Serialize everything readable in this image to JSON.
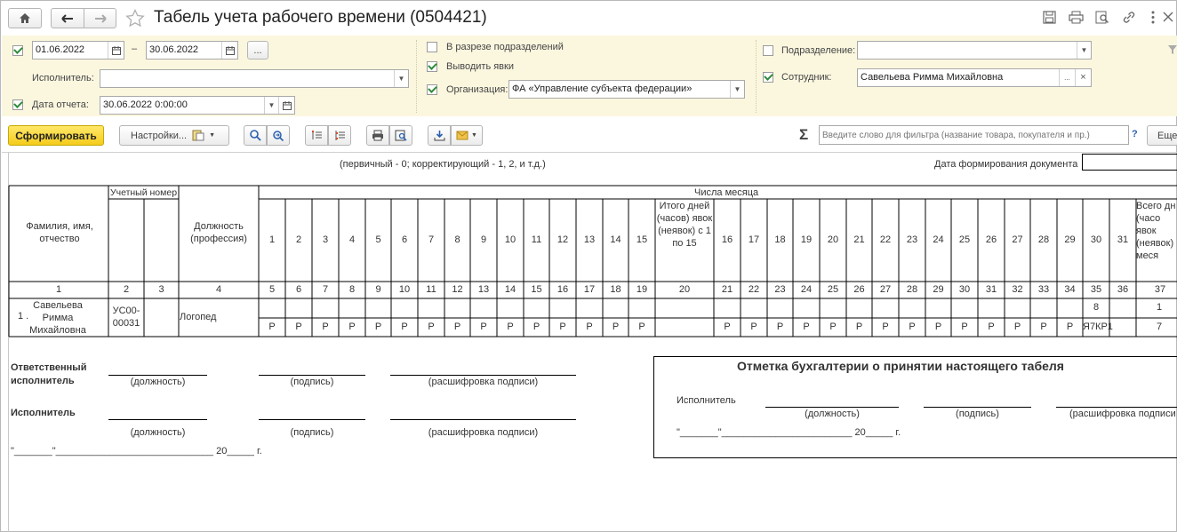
{
  "window": {
    "title": "Табель учета рабочего времени (0504421)"
  },
  "filters": {
    "date_from": "01.06.2022",
    "dash": "–",
    "date_to": "30.06.2022",
    "period_btn": "...",
    "executor_label": "Исполнитель:",
    "executor_value": "",
    "report_date_label": "Дата отчета:",
    "report_date_value": "30.06.2022  0:00:00",
    "by_division_label": "В разрезе подразделений",
    "show_attendance_label": "Выводить явки",
    "organization_label": "Организация:",
    "organization_value": "ФА «Управление субъекта федерации»",
    "division_label": "Подразделение:",
    "division_value": "",
    "employee_label": "Сотрудник:",
    "employee_value": "Савельева Римма Михайловна",
    "more": "...",
    "clear": "×"
  },
  "toolbar": {
    "generate": "Сформировать",
    "settings": "Настройки...",
    "search_placeholder": "Введите слово для фильтра (название товара, покупателя и пр.)",
    "help": "?",
    "more": "Еще",
    "sigma": "Σ"
  },
  "report": {
    "note": "(первичный - 0; корректирующий - 1, 2, и т.д.)",
    "doc_date_label": "Дата формирования документа",
    "h_fio": "Фамилия, имя, отчество",
    "h_account": "Учетный номер",
    "h_position": "Должность (профессия)",
    "h_days": "Числа месяца",
    "h_total15": "Итого дней (часов) явок (неявок) с 1 по 15",
    "h_total_all": "Всего дн (часо явок (неявок) меся",
    "days_first": [
      "1",
      "2",
      "3",
      "4",
      "5",
      "6",
      "7",
      "8",
      "9",
      "10",
      "11",
      "12",
      "13",
      "14",
      "15"
    ],
    "days_second": [
      "16",
      "17",
      "18",
      "19",
      "20",
      "21",
      "22",
      "23",
      "24",
      "25",
      "26",
      "27",
      "28",
      "29",
      "30",
      "31"
    ],
    "col_numbers": [
      "1",
      "2",
      "3",
      "4",
      "5",
      "6",
      "7",
      "8",
      "9",
      "10",
      "11",
      "12",
      "13",
      "14",
      "15",
      "16",
      "17",
      "18",
      "19",
      "20",
      "21",
      "22",
      "23",
      "24",
      "25",
      "26",
      "27",
      "28",
      "29",
      "30",
      "31",
      "32",
      "33",
      "34",
      "35",
      "36",
      "37"
    ],
    "row": {
      "n": "1 .",
      "fio": "Савельева Римма Михайловна",
      "tab": "УС00-00031",
      "position": "Логопед",
      "mark": "Р",
      "d30_hours": "8",
      "d30_code": "Я7КР1",
      "total_days": "1",
      "total_hours": "7"
    },
    "sig": {
      "resp_label": "Ответственный исполнитель",
      "exec_label": "Исполнитель",
      "position": "(должность)",
      "signature": "(подпись)",
      "decode": "(расшифровка подписи)",
      "date_line": "\"_______\"_____________________________ 20_____  г."
    },
    "acc": {
      "title": "Отметка бухгалтерии о принятии настоящего табеля",
      "exec_label": "Исполнитель",
      "position": "(должность)",
      "signature": "(подпись)",
      "decode": "(расшифровка подписи",
      "date_line": "\"_______\"________________________ 20_____  г."
    }
  }
}
